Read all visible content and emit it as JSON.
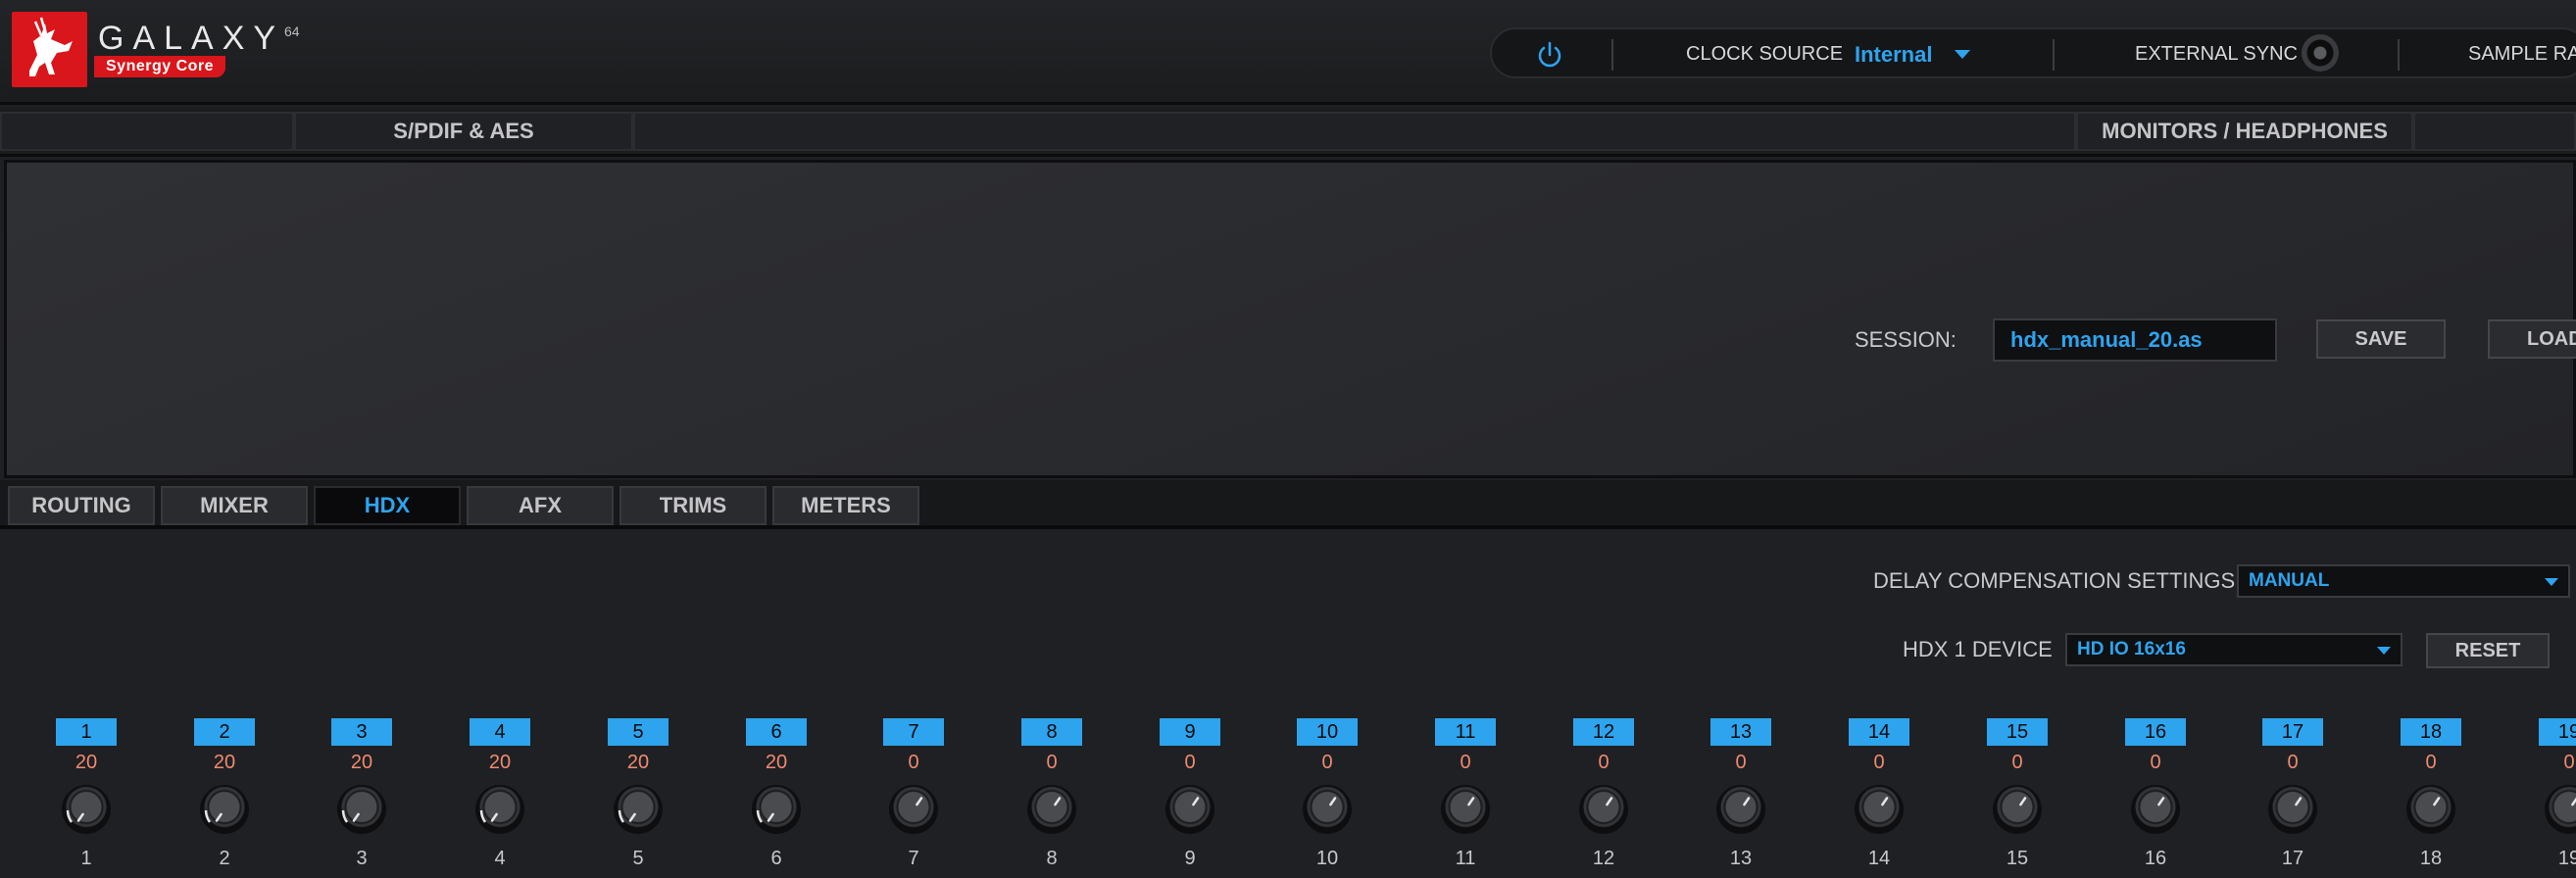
{
  "header": {
    "brand": "GALAXY",
    "brand_superscript": "64",
    "brand_subtitle": "Synergy Core",
    "clock_source_label": "CLOCK SOURCE",
    "clock_source_value": "Internal",
    "external_sync_label": "EXTERNAL SYNC",
    "sample_rate_label": "SAMPLE RA"
  },
  "subtabs": {
    "spdif": "S/PDIF & AES",
    "monitors": "MONITORS / HEADPHONES"
  },
  "session": {
    "label": "SESSION:",
    "value": "hdx_manual_20.as",
    "save": "SAVE",
    "load": "LOAD"
  },
  "tabs": [
    "ROUTING",
    "MIXER",
    "HDX",
    "AFX",
    "TRIMS",
    "METERS"
  ],
  "active_tab": "HDX",
  "hdx": {
    "delay_comp_label": "DELAY COMPENSATION SETTINGS",
    "delay_comp_value": "MANUAL",
    "device_label": "HDX 1 DEVICE",
    "device_value": "HD IO 16x16",
    "reset": "RESET"
  },
  "channels": [
    {
      "badge": "1",
      "value": "20",
      "label": "1"
    },
    {
      "badge": "2",
      "value": "20",
      "label": "2"
    },
    {
      "badge": "3",
      "value": "20",
      "label": "3"
    },
    {
      "badge": "4",
      "value": "20",
      "label": "4"
    },
    {
      "badge": "5",
      "value": "20",
      "label": "5"
    },
    {
      "badge": "6",
      "value": "20",
      "label": "6"
    },
    {
      "badge": "7",
      "value": "0",
      "label": "7"
    },
    {
      "badge": "8",
      "value": "0",
      "label": "8"
    },
    {
      "badge": "9",
      "value": "0",
      "label": "9"
    },
    {
      "badge": "10",
      "value": "0",
      "label": "10"
    },
    {
      "badge": "11",
      "value": "0",
      "label": "11"
    },
    {
      "badge": "12",
      "value": "0",
      "label": "12"
    },
    {
      "badge": "13",
      "value": "0",
      "label": "13"
    },
    {
      "badge": "14",
      "value": "0",
      "label": "14"
    },
    {
      "badge": "15",
      "value": "0",
      "label": "15"
    },
    {
      "badge": "16",
      "value": "0",
      "label": "16"
    },
    {
      "badge": "17",
      "value": "0",
      "label": "17"
    },
    {
      "badge": "18",
      "value": "0",
      "label": "18"
    },
    {
      "badge": "19",
      "value": "0",
      "label": "19"
    }
  ],
  "colors": {
    "accent": "#2ea4ee",
    "brand_red": "#d9161b",
    "value_orange": "#f08a70"
  },
  "icons": [
    "antelope-logo-icon",
    "power-icon",
    "chevron-down-icon",
    "sync-indicator-icon",
    "knob-icon"
  ]
}
